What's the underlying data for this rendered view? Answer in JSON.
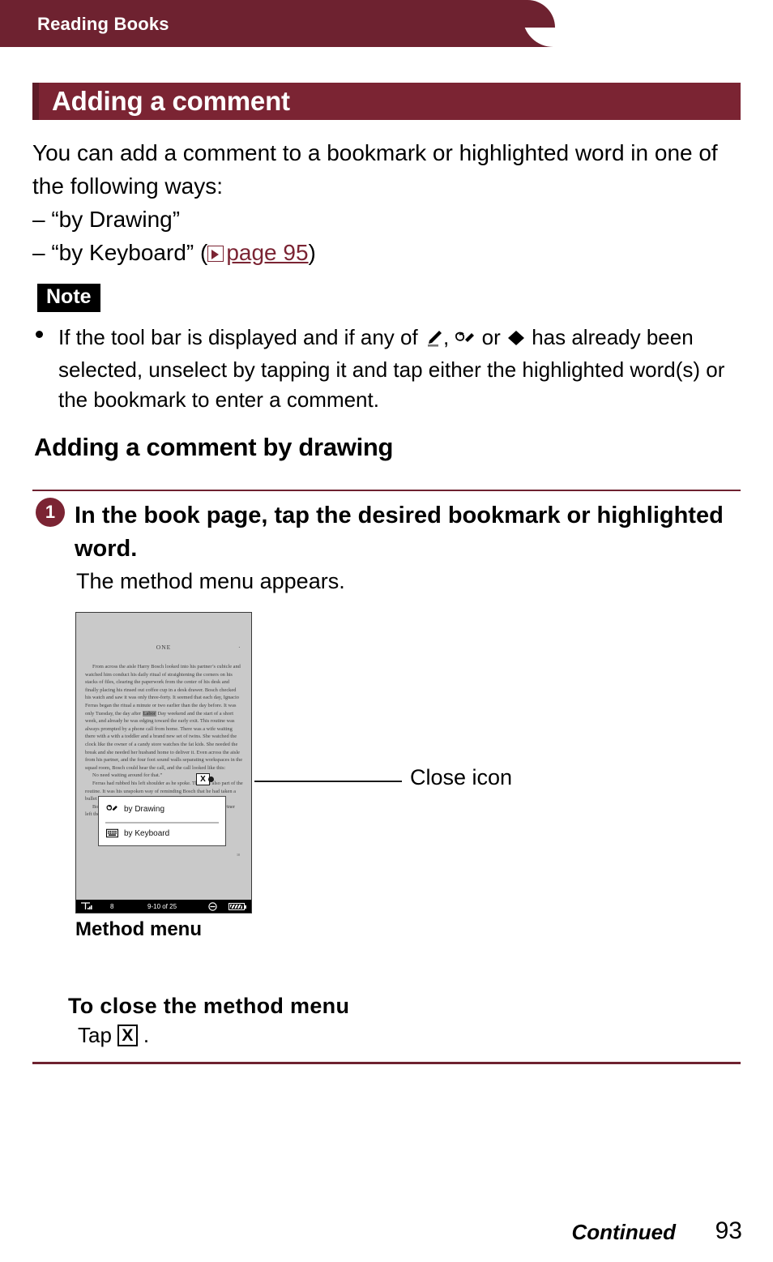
{
  "header": {
    "chapter_label": "Reading Books"
  },
  "title_bar": {
    "text": "Adding a comment"
  },
  "intro": {
    "paragraph": "You can add a comment to a bookmark or highlighted word in one of the following ways:",
    "option_1": "– “by Drawing”",
    "option_2_prefix": "– “by Keyboard” (",
    "option_2_link": "page 95",
    "option_2_suffix": ")"
  },
  "note": {
    "badge": "Note",
    "text_before_icons": "If the tool bar is displayed and if any of ",
    "icon_sep_1": ", ",
    "icon_sep_2": " or ",
    "text_after_icons": " has already been selected, unselect by tapping it and tap either the highlighted word(s) or the bookmark to enter a comment.",
    "icons": [
      "highlighter-pen-icon",
      "drawing-pen-icon",
      "eraser-icon"
    ]
  },
  "subheading": "Adding a comment by drawing",
  "step": {
    "number": "1",
    "title": "In the book page, tap the desired bookmark or highlighted word.",
    "subtitle": "The method menu appears."
  },
  "device": {
    "chapter": "ONE",
    "page_mark_top": "•",
    "page_mark_bottom": "10",
    "body_paragraph_1": "From across the aisle Harry Bosch looked into his partner’s cubicle and watched him conduct his daily ritual of straightening the corners on his stacks of files, clearing the paperwork from the center of his desk and finally placing his rinsed out coffee cup in a desk drawer. Bosch checked his watch and saw it was only three-forty. It seemed that each day, Ignacio Ferras began the ritual a minute or two earlier than the day before. It was only Tuesday, the day after ",
    "highlighted_word": "Labor",
    "body_paragraph_1_cont": " Day weekend and the start of a short week, and already he was edging toward the early exit. This routine was always prompted by a phone call from home. There was a wife waiting there with a with a toddler and a brand new set of twins. She watched the clock like the owner of a candy store watches the fat kids. She needed the break and she needed her husband home to deliver it. Even across the aisle from his partner, and the four foot sound walls separating workspaces in the squad room, Bosch could hear the call, and the call looked like this:",
    "body_paragraph_2": "No need waiting around for that.”",
    "body_paragraph_3": "Ferras had rubbed his left shoulder as he spoke. This was also part of the routine. It was his unspoken way of reminding Bosch that he had taken a bullet a couple years before and had earned the early exit.",
    "body_paragraph_4": "Bosch just nodded. The issue wasn’t really about whether his partner left the job early or what he had earned.",
    "close_icon_label": "X",
    "method_menu": {
      "item_1": "by Drawing",
      "item_1_icon": "drawing-pen-icon",
      "item_2": "by Keyboard",
      "item_2_icon": "keyboard-icon"
    },
    "status_bar": {
      "signal_icon": "signal-strength-icon",
      "bookmark_count": "8",
      "page_range": "9-10 of 25",
      "zoom_out_icon": "minus-circle-icon",
      "battery_icon": "battery-icon"
    }
  },
  "callout": {
    "label": "Close icon"
  },
  "caption": "Method menu",
  "close_section": {
    "heading": "To close the method menu",
    "instruction_prefix": "Tap",
    "instruction_key": "X",
    "instruction_suffix": "."
  },
  "footer": {
    "continued": "Continued",
    "page_number": "93"
  },
  "colors": {
    "brand_dark_red": "#6e2230",
    "title_bar_red": "#7b2433",
    "link_red": "#7b2433",
    "device_gray": "#c9c9c9"
  }
}
